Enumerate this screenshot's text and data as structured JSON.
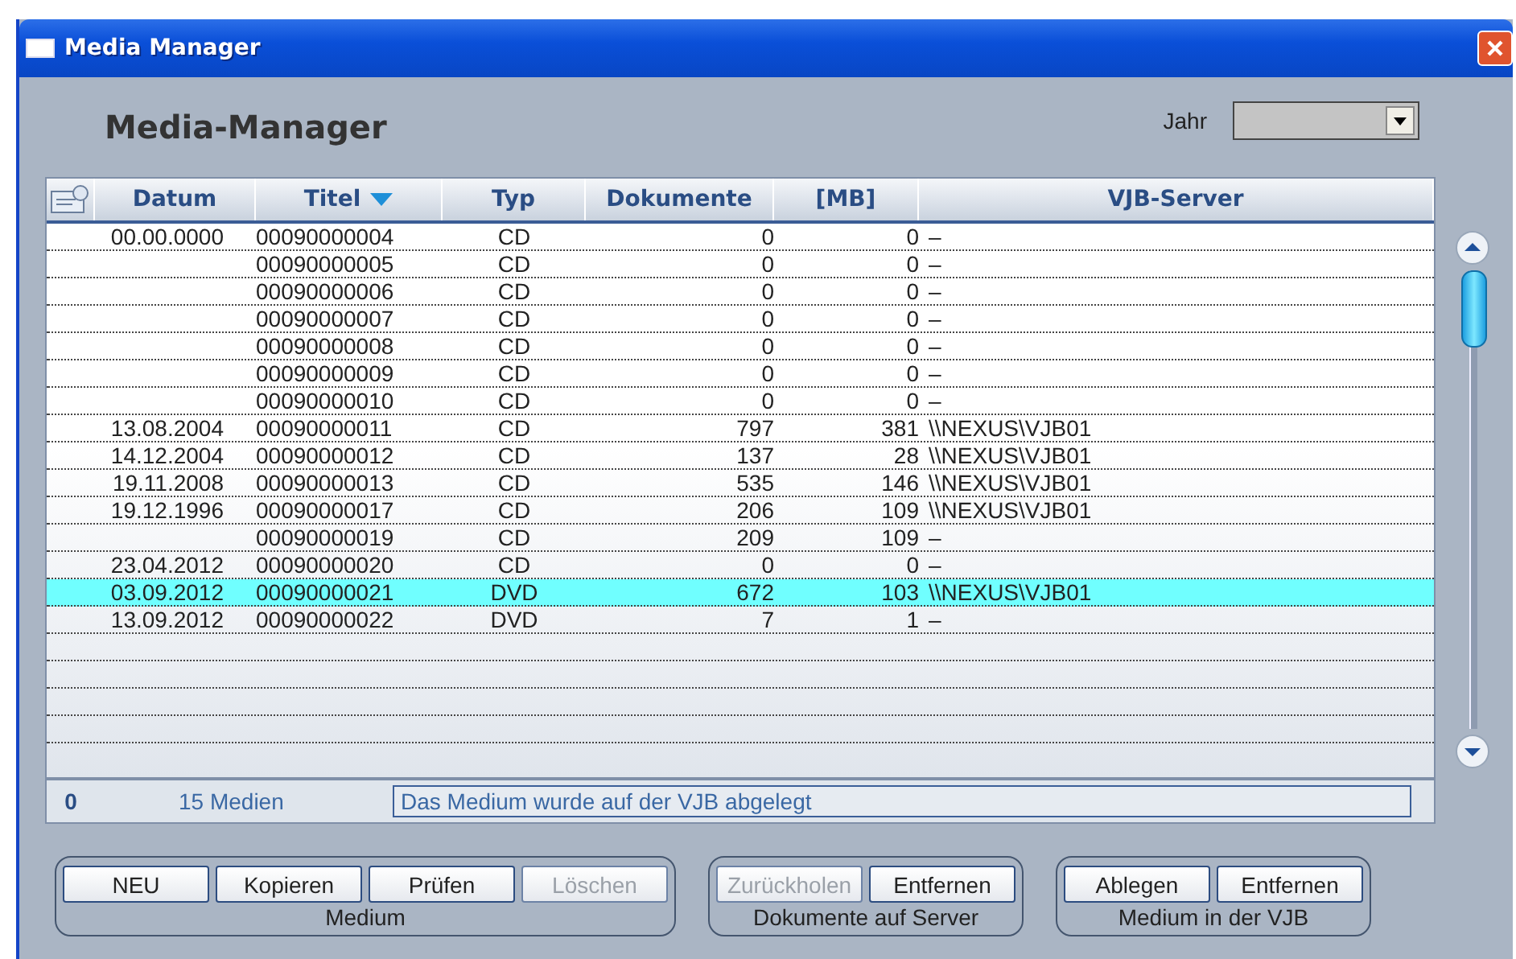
{
  "window": {
    "title": "Media Manager"
  },
  "heading": "Media-Manager",
  "year": {
    "label": "Jahr"
  },
  "table": {
    "columns": [
      {
        "label": "Datum",
        "sorted": false
      },
      {
        "label": "Titel",
        "sorted": true
      },
      {
        "label": "Typ",
        "sorted": false
      },
      {
        "label": "Dokumente",
        "sorted": false
      },
      {
        "label": "[MB]",
        "sorted": false
      },
      {
        "label": "VJB-Server",
        "sorted": false
      }
    ],
    "rows": [
      {
        "cells": [
          "00.00.0000",
          "00090000004",
          "CD",
          "0",
          "0",
          "–"
        ],
        "selected": false
      },
      {
        "cells": [
          "",
          "00090000005",
          "CD",
          "0",
          "0",
          "–"
        ],
        "selected": false
      },
      {
        "cells": [
          "",
          "00090000006",
          "CD",
          "0",
          "0",
          "–"
        ],
        "selected": false
      },
      {
        "cells": [
          "",
          "00090000007",
          "CD",
          "0",
          "0",
          "–"
        ],
        "selected": false
      },
      {
        "cells": [
          "",
          "00090000008",
          "CD",
          "0",
          "0",
          "–"
        ],
        "selected": false
      },
      {
        "cells": [
          "",
          "00090000009",
          "CD",
          "0",
          "0",
          "–"
        ],
        "selected": false
      },
      {
        "cells": [
          "",
          "00090000010",
          "CD",
          "0",
          "0",
          "–"
        ],
        "selected": false
      },
      {
        "cells": [
          "13.08.2004",
          "00090000011",
          "CD",
          "797",
          "381",
          "\\\\NEXUS\\VJB01"
        ],
        "selected": false
      },
      {
        "cells": [
          "14.12.2004",
          "00090000012",
          "CD",
          "137",
          "28",
          "\\\\NEXUS\\VJB01"
        ],
        "selected": false
      },
      {
        "cells": [
          "19.11.2008",
          "00090000013",
          "CD",
          "535",
          "146",
          "\\\\NEXUS\\VJB01"
        ],
        "selected": false
      },
      {
        "cells": [
          "19.12.1996",
          "00090000017",
          "CD",
          "206",
          "109",
          "\\\\NEXUS\\VJB01"
        ],
        "selected": false
      },
      {
        "cells": [
          "",
          "00090000019",
          "CD",
          "209",
          "109",
          "–"
        ],
        "selected": false
      },
      {
        "cells": [
          "23.04.2012",
          "00090000020",
          "CD",
          "0",
          "0",
          "–"
        ],
        "selected": false
      },
      {
        "cells": [
          "03.09.2012",
          "00090000021",
          "DVD",
          "672",
          "103",
          "\\\\NEXUS\\VJB01"
        ],
        "selected": true
      },
      {
        "cells": [
          "13.09.2012",
          "00090000022",
          "DVD",
          "7",
          "1",
          "–"
        ],
        "selected": false
      }
    ]
  },
  "status_bar": {
    "count": "0",
    "media": "15 Medien",
    "message": "Das Medium wurde auf der VJB abgelegt"
  },
  "groups": [
    {
      "label": "Medium",
      "buttons": [
        {
          "label": "NEU",
          "disabled": false
        },
        {
          "label": "Kopieren",
          "disabled": false
        },
        {
          "label": "Prüfen",
          "disabled": false
        },
        {
          "label": "Löschen",
          "disabled": true
        }
      ]
    },
    {
      "label": "Dokumente auf Server",
      "buttons": [
        {
          "label": "Zurückholen",
          "disabled": true
        },
        {
          "label": "Entfernen",
          "disabled": false
        }
      ]
    },
    {
      "label": "Medium in der VJB",
      "buttons": [
        {
          "label": "Ablegen",
          "disabled": false
        },
        {
          "label": "Entfernen",
          "disabled": false
        }
      ]
    }
  ]
}
